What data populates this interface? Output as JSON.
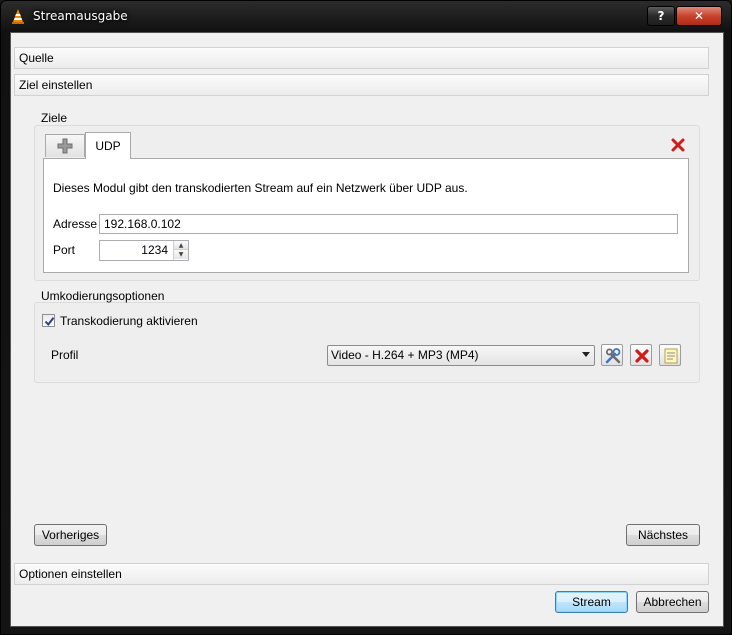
{
  "window": {
    "title": "Streamausgabe",
    "help_label": "?",
    "close_label": "✕"
  },
  "sections": {
    "source": "Quelle",
    "destination": "Ziel einstellen",
    "options": "Optionen einstellen"
  },
  "destinations": {
    "group_title": "Ziele",
    "tabs": [
      {
        "label": "UDP"
      }
    ],
    "description": "Dieses Modul gibt den transkodierten Stream auf ein Netzwerk über UDP aus.",
    "address_label": "Adresse",
    "address_value": "192.168.0.102",
    "port_label": "Port",
    "port_value": "1234"
  },
  "transcode": {
    "group_title": "Umkodierungsoptionen",
    "checkbox_label": "Transkodierung aktivieren",
    "checked": true,
    "profile_label": "Profil",
    "profile_selected": "Video - H.264 + MP3 (MP4)"
  },
  "nav": {
    "back_label": "Vorheriges",
    "next_label": "Nächstes"
  },
  "footer": {
    "stream_label": "Stream",
    "cancel_label": "Abbrechen"
  },
  "colors": {
    "accent": "#3c7fb1",
    "delete_red": "#d11a1a"
  }
}
